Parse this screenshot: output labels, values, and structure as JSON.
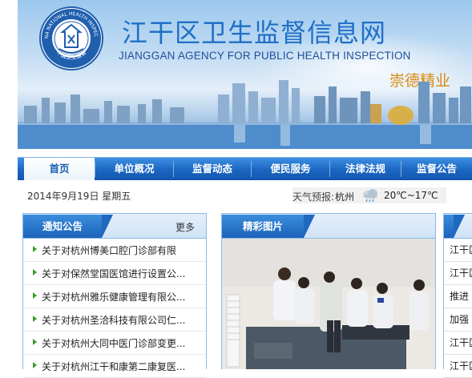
{
  "header": {
    "title": "江干区卫生监督信息网",
    "subtitle": "JIANGGAN AGENCY FOR PUBLIC HEALTH INSPECTION",
    "slogan": "崇德精业",
    "emblem_text_top": "CHINA NATIONAL HEALTH INSPECTOR",
    "emblem_text_bottom": "中国卫生监督"
  },
  "nav": {
    "items": [
      {
        "label": "首页",
        "active": true
      },
      {
        "label": "单位概况"
      },
      {
        "label": "监督动态"
      },
      {
        "label": "便民服务"
      },
      {
        "label": "法律法规"
      },
      {
        "label": "监督公告"
      }
    ]
  },
  "info_bar": {
    "date": "2014年9月19日 星期五",
    "weather_label": "天气预报:",
    "city": "杭州",
    "weather_icon": "cloud-rain-icon",
    "temperature": "20℃~17℃"
  },
  "notice_panel": {
    "title": "通知公告",
    "more_label": "更多",
    "items": [
      "关于对杭州博美口腔门诊部有限",
      "关于对保然堂国医馆进行设置公...",
      "关于对杭州雅乐健康管理有限公...",
      "关于对杭州圣洽科技有限公司仁...",
      "关于对杭州大同中医门诊部变更...",
      "关于对杭州江干和康第二康复医..."
    ]
  },
  "photo_panel": {
    "title": "精彩图片"
  },
  "right_panel": {
    "items": [
      "江干区",
      "江干区",
      "推进",
      "加强",
      "江干区",
      "江干区"
    ]
  },
  "colors": {
    "nav_blue": "#1a66c2",
    "title_blue": "#1f6fc7",
    "slogan_orange": "#d98a12",
    "arrow_green": "#3d9a2e",
    "panel_border": "#8db8e4"
  }
}
